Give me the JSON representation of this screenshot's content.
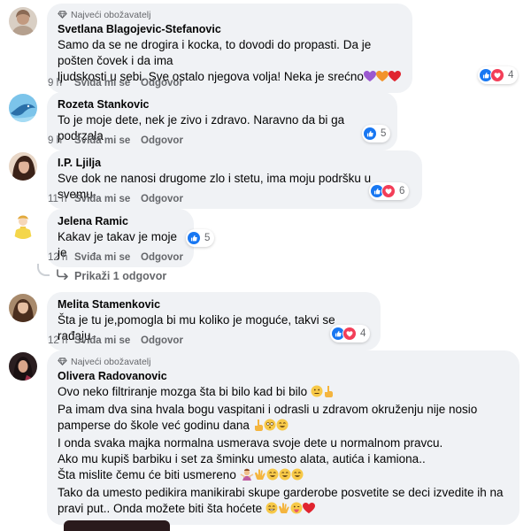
{
  "badge_label": "Najveći obožavatelj",
  "comments": [
    {
      "author": "Svetlana Blagojevic-Stefanovic",
      "text_lines": [
        "Samo da se ne drogira i kocka, to dovodi do propasti. Da je pošten čovek i da ima",
        "ljudskosti u sebi. Sve ostalo njegova volja! Neka je srećno"
      ],
      "time": "9 h",
      "like_label": "Sviđa mi se",
      "reply_label": "Odgovor",
      "reaction_count": "4",
      "avatar_color": "#c9b8a8"
    },
    {
      "author": "Rozeta Stankovic",
      "text_lines": [
        "To je moje dete, nek je zivo i zdravo. Naravno da bi ga podrzala"
      ],
      "time": "9 h",
      "like_label": "Sviđa mi se",
      "reply_label": "Odgovor",
      "reaction_count": "5",
      "avatar_color": "#4aa3d6"
    },
    {
      "author": "I.P. Ljilja",
      "text_lines": [
        "Sve dok ne nanosi drugome zlo i stetu, ima moju podršku u svemu."
      ],
      "time": "11 h",
      "like_label": "Sviđa mi se",
      "reply_label": "Odgovor",
      "reaction_count": "6",
      "avatar_color": "#5a3a2e"
    },
    {
      "author": "Jelena Ramic",
      "text_lines": [
        "Kakav je takav je moje je"
      ],
      "time": "12 h",
      "like_label": "Sviđa mi se",
      "reply_label": "Odgovor",
      "reaction_count": "5",
      "avatar_color": "#f4d64a",
      "replies_label": "Prikaži 1 odgovor"
    },
    {
      "author": "Melita Stamenkovic",
      "text_lines": [
        "Šta je tu je,pomogla bi mu koliko je moguće, takvi se rađaju"
      ],
      "time": "12 h",
      "like_label": "Sviđa mi se",
      "reply_label": "Odgovor",
      "reaction_count": "4",
      "avatar_color": "#8a6a50"
    },
    {
      "author": "Olivera Radovanovic",
      "text_lines": [
        "Ovo neko filtriranje mozga šta bi bilo kad bi bilo",
        "Pa imam dva sina hvala bogu vaspitani i odrasli u zdravom okruženju nije nosio",
        "pamperse do škole već godinu dana",
        "I onda svaka majka normalna usmerava svoje dete u normalnom pravcu.",
        "Ako mu kupiš barbiku i set za šminku umesto alata, autića i kamiona..",
        "Šta mislite čemu će biti usmereno",
        "Tako da umesto pedikira manikirabi skupe garderobe posvetite se deci izvedite ih na",
        "pravi put.. Onda možete biti šta hoćete"
      ],
      "avatar_color": "#3a2a2a"
    }
  ],
  "colors": {
    "like_blue": "#1877f2",
    "love_red": "#f33e58",
    "bubble_bg": "#f0f2f5",
    "meta_gray": "#65676b"
  }
}
